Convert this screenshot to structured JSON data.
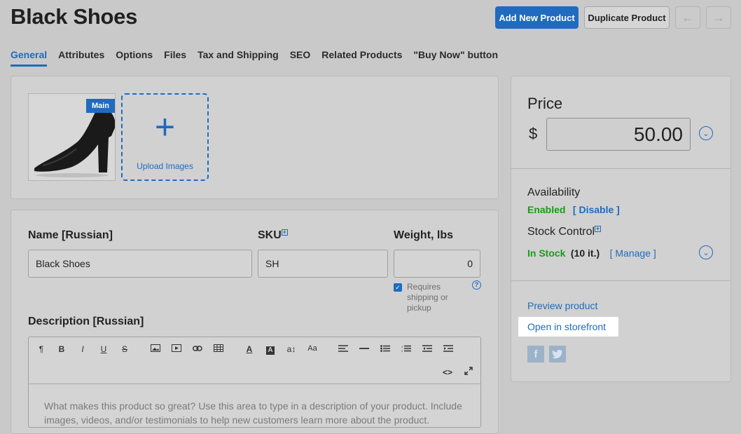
{
  "header": {
    "title": "Black Shoes",
    "add_new_label": "Add New Product",
    "duplicate_label": "Duplicate Product",
    "prev_arrow": "←",
    "next_arrow": "→"
  },
  "tabs": [
    {
      "label": "General",
      "active": true
    },
    {
      "label": "Attributes"
    },
    {
      "label": "Options"
    },
    {
      "label": "Files"
    },
    {
      "label": "Tax and Shipping"
    },
    {
      "label": "SEO"
    },
    {
      "label": "Related Products"
    },
    {
      "label": "\"Buy Now\" button"
    }
  ],
  "images": {
    "main_badge": "Main",
    "upload_plus": "+",
    "upload_label": "Upload Images"
  },
  "form": {
    "name_label": "Name [Russian]",
    "name_value": "Black Shoes",
    "sku_label": "SKU",
    "sku_value": "SH",
    "weight_label": "Weight, lbs",
    "weight_value": "0",
    "requires_shipping": "Requires shipping or pickup",
    "help": "?",
    "description_label": "Description [Russian]",
    "description_placeholder": "What makes this product so great? Use this area to type in a description of your product. Include images, videos, and/or testimonials to help new customers learn more about the product."
  },
  "editor_toolbar": [
    "¶",
    "B",
    "I",
    "U",
    "S",
    "img",
    "vid",
    "link",
    "table",
    "A",
    "A",
    "a↕",
    "Aa",
    "align",
    "hr",
    "ul",
    "ol",
    "outdent",
    "indent",
    "<>",
    "fullscreen"
  ],
  "sidebar": {
    "price_label": "Price",
    "currency": "$",
    "price_value": "50.00",
    "availability_label": "Availability",
    "availability_status": "Enabled",
    "disable_link": "[ Disable ]",
    "stock_label": "Stock Control",
    "stock_status": "In Stock",
    "stock_count": "(10 it.)",
    "manage_link": "[ Manage ]",
    "preview_link": "Preview product",
    "storefront_link": "Open in storefront",
    "facebook": "f",
    "twitter": "t"
  },
  "colors": {
    "accent": "#1f6bbf",
    "success": "#199b19",
    "background": "#c9c9c9"
  }
}
